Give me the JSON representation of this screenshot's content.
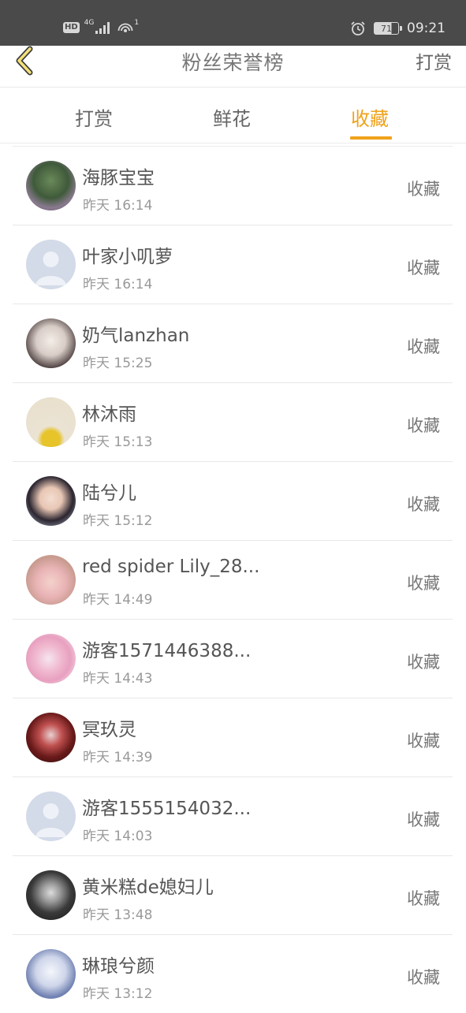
{
  "status_bar": {
    "network_label": "HD",
    "signal_label": "4G",
    "hotspot_count": "1",
    "battery": "71",
    "time": "09:21"
  },
  "header": {
    "title": "粉丝荣誉榜",
    "action_label": "打赏"
  },
  "tabs": [
    {
      "label": "打赏",
      "active": false
    },
    {
      "label": "鲜花",
      "active": false
    },
    {
      "label": "收藏",
      "active": true
    }
  ],
  "colors": {
    "accent": "#f0a21b",
    "status_bar_bg": "#4a4a4a",
    "text_primary": "#555555",
    "text_secondary": "#999999",
    "divider": "#e8e8e8"
  },
  "list": [
    {
      "name": "海豚宝宝",
      "time": "昨天 16:14",
      "action": "收藏",
      "avatar": "photo"
    },
    {
      "name": "叶家小叽萝",
      "time": "昨天 16:14",
      "action": "收藏",
      "avatar": "default-avatar"
    },
    {
      "name": "奶气lanzhan",
      "time": "昨天 15:25",
      "action": "收藏",
      "avatar": "photo"
    },
    {
      "name": "林沐雨",
      "time": "昨天 15:13",
      "action": "收藏",
      "avatar": "photo"
    },
    {
      "name": "陆兮儿",
      "time": "昨天 15:12",
      "action": "收藏",
      "avatar": "photo"
    },
    {
      "name": "red spider Lily_28...",
      "time": "昨天 14:49",
      "action": "收藏",
      "avatar": "photo"
    },
    {
      "name": "游客1571446388...",
      "time": "昨天 14:43",
      "action": "收藏",
      "avatar": "photo"
    },
    {
      "name": "冥玖灵",
      "time": "昨天 14:39",
      "action": "收藏",
      "avatar": "photo"
    },
    {
      "name": "游客1555154032...",
      "time": "昨天 14:03",
      "action": "收藏",
      "avatar": "default-avatar"
    },
    {
      "name": "黄米糕de媳妇儿",
      "time": "昨天 13:48",
      "action": "收藏",
      "avatar": "photo"
    },
    {
      "name": "琳琅兮颜",
      "time": "昨天 13:12",
      "action": "收藏",
      "avatar": "photo"
    }
  ]
}
